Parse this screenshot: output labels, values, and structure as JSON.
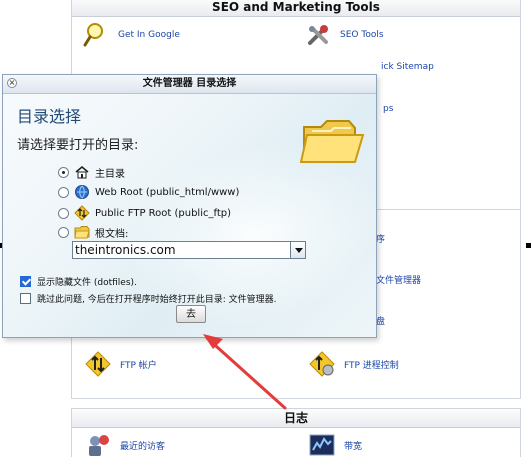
{
  "background": {
    "seo_panel": {
      "title": "SEO and Marketing Tools",
      "items": [
        {
          "label": "Get In Google",
          "icon": "magnifier-icon"
        },
        {
          "label": "SEO Tools",
          "icon": "tools-icon"
        },
        {
          "label": "ick Sitemap",
          "icon": "sitemap-icon"
        },
        {
          "label": "ps",
          "icon": "partial-icon"
        }
      ]
    },
    "files_panel": {
      "items": [
        {
          "label": "序",
          "icon": "partial-icon"
        },
        {
          "label": "文件管理器",
          "icon": "file-manager-icon"
        },
        {
          "label": "盘",
          "icon": "partial-icon"
        },
        {
          "label": "FTP 帐户",
          "icon": "ftp-accounts-icon"
        },
        {
          "label": "FTP 进程控制",
          "icon": "ftp-session-icon"
        }
      ]
    },
    "logs_panel": {
      "title": "日志",
      "items": [
        {
          "label": "最近的访客",
          "icon": "visitors-icon"
        },
        {
          "label": "带宽",
          "icon": "bandwidth-icon"
        }
      ]
    }
  },
  "dialog": {
    "title": "文件管理器 目录选择",
    "heading": "目录选择",
    "subheading": "请选择要打开的目录:",
    "options": [
      {
        "label": "主目录",
        "selected": true,
        "icon": "home-icon"
      },
      {
        "label": "Web Root (public_html/www)",
        "selected": false,
        "icon": "globe-icon"
      },
      {
        "label": "Public FTP Root (public_ftp)",
        "selected": false,
        "icon": "ftp-icon"
      },
      {
        "label": "根文档:",
        "selected": false,
        "icon": "folder-icon"
      }
    ],
    "domain_select_value": "theintronics.com",
    "show_hidden_label": "显示隐藏文件 (dotfiles).",
    "show_hidden_checked": true,
    "skip_question_label": "跳过此问题, 今后在打开程序时始终打开此目录: 文件管理器.",
    "skip_question_checked": false,
    "go_button_label": "去"
  },
  "colors": {
    "dialog_heading": "#234c77",
    "link": "#1b46a8",
    "arrow": "#e53b3b"
  }
}
